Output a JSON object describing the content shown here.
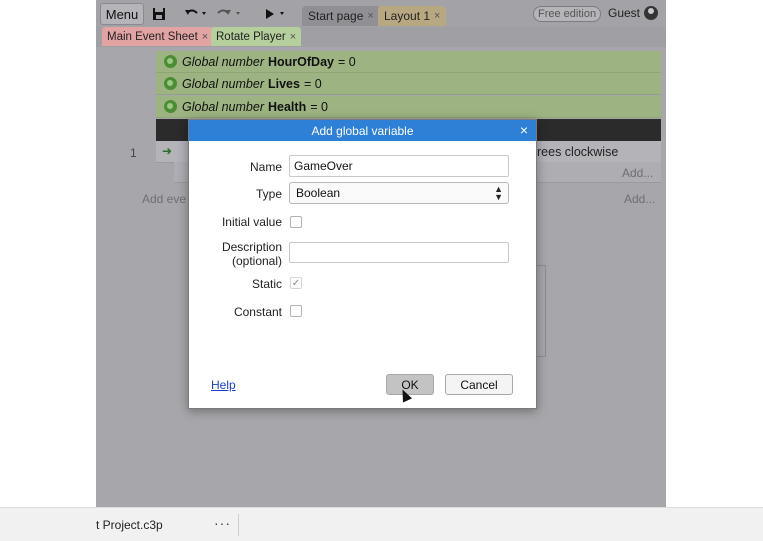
{
  "toolbar": {
    "menu_label": "Menu",
    "save_icon": "floppy-disk-icon",
    "undo_icon": "undo-icon",
    "redo_icon": "redo-icon",
    "play_icon": "play-icon",
    "tabs": [
      {
        "label": "Start page",
        "close": "×"
      },
      {
        "label": "Layout 1",
        "close": "×"
      }
    ],
    "edition_badge": "Free edition",
    "user_label": "Guest"
  },
  "sheet_tabs": [
    {
      "label": "Main Event Sheet",
      "close": "×",
      "color": "#e8a3a3"
    },
    {
      "label": "Rotate Player",
      "close": "×",
      "color": "#b8d3a3"
    }
  ],
  "event_sheet": {
    "globals": [
      {
        "prefix": "Global number",
        "name": "HourOfDay",
        "value": "= 0"
      },
      {
        "prefix": "Global number",
        "name": "Lives",
        "value": "= 0"
      },
      {
        "prefix": "Global number",
        "name": "Health",
        "value": "= 0"
      }
    ],
    "event_number": "1",
    "action_text": "rees clockwise",
    "add_action_1": "Add...",
    "add_action_2": "Add...",
    "add_event": "Add eve"
  },
  "dialog": {
    "title": "Add global variable",
    "close": "×",
    "name_label": "Name",
    "name_value": "GameOver",
    "type_label": "Type",
    "type_value": "Boolean",
    "initial_label": "Initial value",
    "description_label": "Description\n(optional)",
    "description_value": "",
    "static_label": "Static",
    "static_check": "✓",
    "constant_label": "Constant",
    "help_label": "Help",
    "ok_label": "OK",
    "cancel_label": "Cancel"
  },
  "status_bar": {
    "project_name": "t Project.c3p",
    "more": "···"
  },
  "colors": {
    "dialog_title_bg": "#2e80d6",
    "global_row_bg": "#9db482",
    "link": "#1a3fcf"
  }
}
